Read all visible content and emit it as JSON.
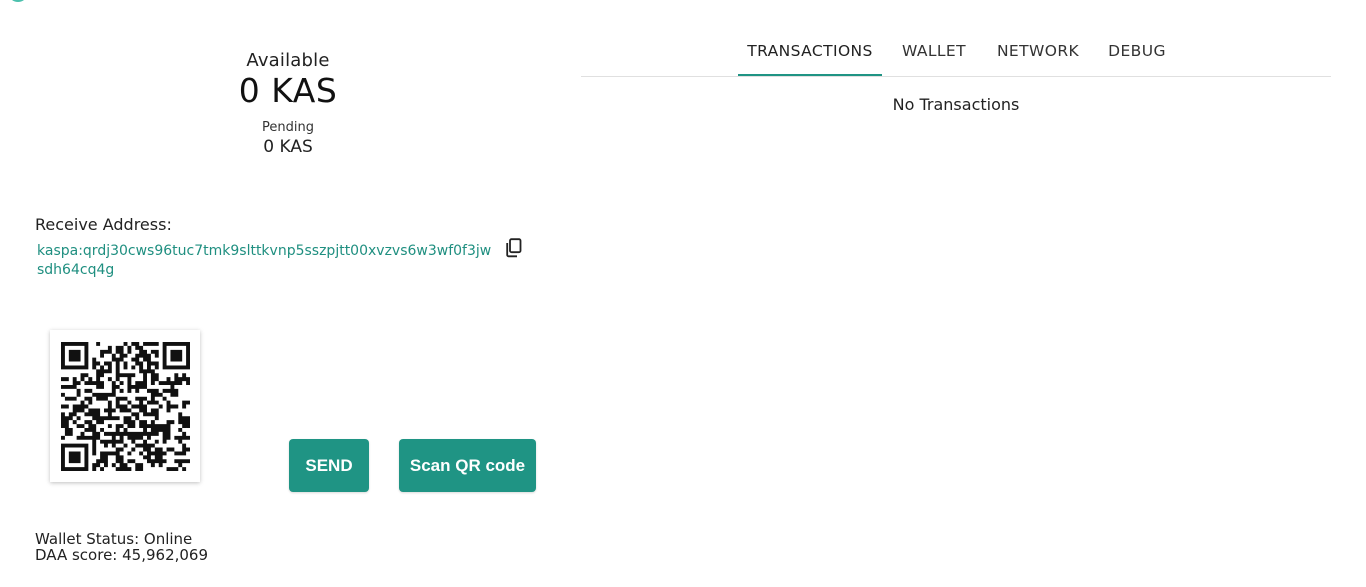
{
  "balance": {
    "available_label": "Available",
    "available_value": "0 KAS",
    "pending_label": "Pending",
    "pending_value": "0 KAS"
  },
  "receive": {
    "label": "Receive Address:",
    "address": "kaspa:qrdj30cws96tuc7tmk9slttkvnp5sszpjtt00xvzvs6w3wf0f3jwsdh64cq4g",
    "copy_icon": "copy-icon",
    "qr_icon": "qr-code"
  },
  "actions": {
    "send_label": "SEND",
    "scan_label": "Scan QR code"
  },
  "status": {
    "wallet_status": "Wallet Status: Online",
    "daa_score": "DAA score: 45,962,069"
  },
  "tabs": [
    {
      "label": "TRANSACTIONS",
      "active": true
    },
    {
      "label": "WALLET",
      "active": false
    },
    {
      "label": "NETWORK",
      "active": false
    },
    {
      "label": "DEBUG",
      "active": false
    }
  ],
  "transactions": {
    "empty_text": "No Transactions"
  },
  "colors": {
    "accent": "#1f9484",
    "link": "#1f8f80",
    "logo": "#4cc0ad"
  }
}
